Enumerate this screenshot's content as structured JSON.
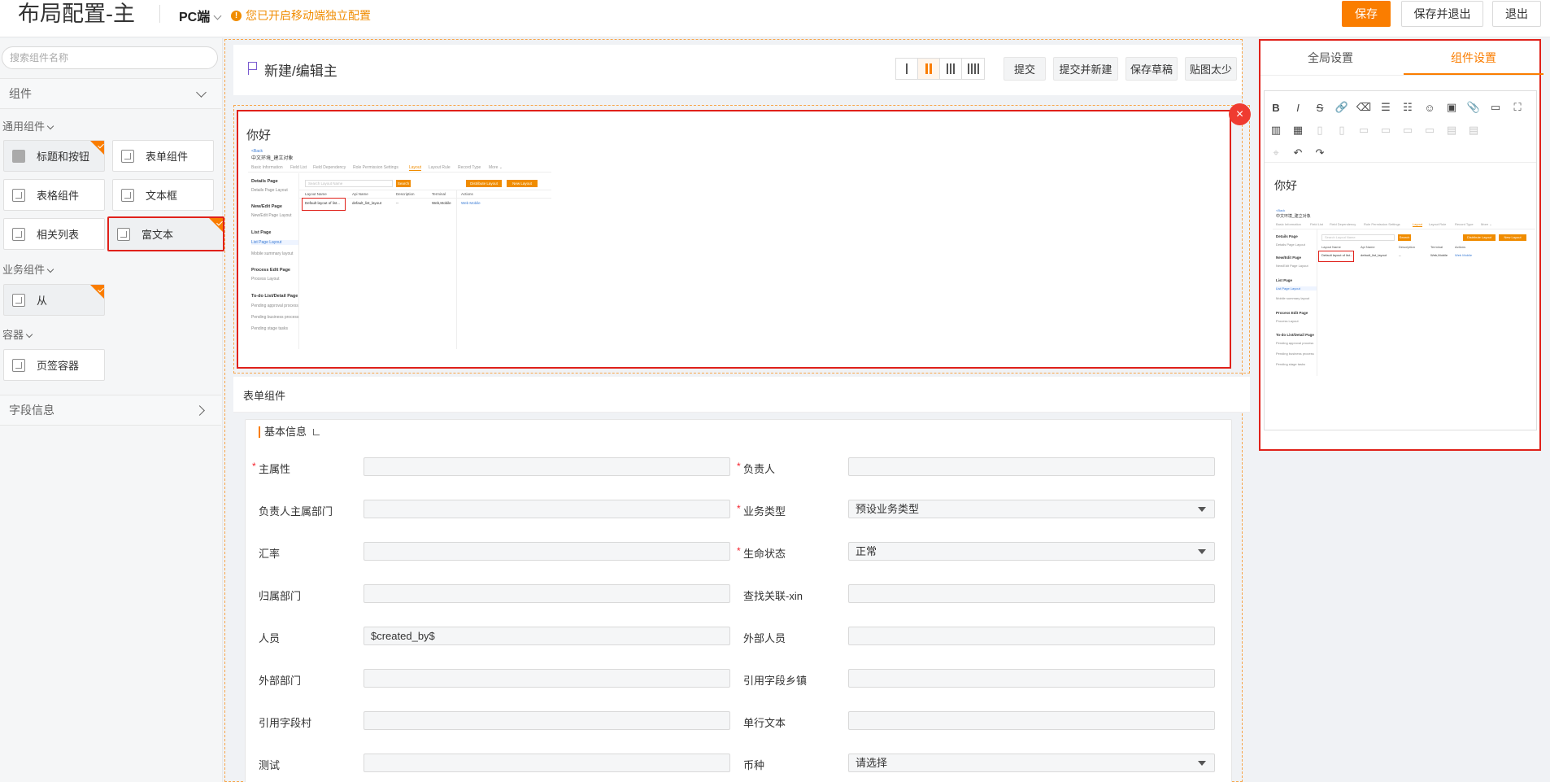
{
  "header": {
    "title": "布局配置-主",
    "platform": "PC端",
    "warning": "您已开启移动端独立配置",
    "buttons": {
      "save": "保存",
      "save_exit": "保存并退出",
      "exit": "退出"
    }
  },
  "left": {
    "search_placeholder": "搜索组件名称",
    "components_section": "组件",
    "groups": {
      "common": "通用组件",
      "business": "业务组件",
      "container": "容器"
    },
    "common_items": [
      "标题和按钮",
      "表单组件",
      "表格组件",
      "文本框",
      "相关列表",
      "富文本"
    ],
    "business_items": [
      "从"
    ],
    "container_items": [
      "页签容器"
    ],
    "fields_section": "字段信息"
  },
  "canvas": {
    "page_title": "新建/编辑主",
    "actions": [
      "提交",
      "提交并新建",
      "保存草稿",
      "贴图太少"
    ],
    "rich_text_hello": "你好",
    "form_section_title": "表单组件",
    "form_group_title": "基本信息",
    "fields": [
      {
        "label": "主属性",
        "required": true,
        "value": "",
        "dropdown": false
      },
      {
        "label": "负责人",
        "required": true,
        "value": "",
        "dropdown": false
      },
      {
        "label": "负责人主属部门",
        "required": false,
        "value": "",
        "dropdown": false
      },
      {
        "label": "业务类型",
        "required": true,
        "value": "预设业务类型",
        "dropdown": true
      },
      {
        "label": "汇率",
        "required": false,
        "value": "",
        "dropdown": false
      },
      {
        "label": "生命状态",
        "required": true,
        "value": "正常",
        "dropdown": true
      },
      {
        "label": "归属部门",
        "required": false,
        "value": "",
        "dropdown": false
      },
      {
        "label": "查找关联-xin",
        "required": false,
        "value": "",
        "dropdown": false
      },
      {
        "label": "人员",
        "required": false,
        "value": "$created_by$",
        "dropdown": false
      },
      {
        "label": "外部人员",
        "required": false,
        "value": "",
        "dropdown": false
      },
      {
        "label": "外部部门",
        "required": false,
        "value": "",
        "dropdown": false
      },
      {
        "label": "引用字段乡镇",
        "required": false,
        "value": "",
        "dropdown": false
      },
      {
        "label": "引用字段村",
        "required": false,
        "value": "",
        "dropdown": false
      },
      {
        "label": "单行文本",
        "required": false,
        "value": "",
        "dropdown": false
      },
      {
        "label": "测试",
        "required": false,
        "value": "",
        "dropdown": false
      },
      {
        "label": "币种",
        "required": false,
        "value": "请选择",
        "dropdown": true
      }
    ]
  },
  "embedded_screenshot": {
    "back": "<Back",
    "title": "中文环境_建立对象",
    "tabs": [
      "Basic Information",
      "Field List",
      "Field Dependency",
      "Role Permission Settings",
      "Layout",
      "Layout Rule",
      "Record Type",
      "More ⌄"
    ],
    "active_tab": "Layout",
    "side": [
      {
        "h": "Details Page",
        "items": [
          "Details Page Layout"
        ]
      },
      {
        "h": "New/Edit Page",
        "items": [
          "New/Edit Page Layout"
        ]
      },
      {
        "h": "List Page",
        "items": [
          "List Page Layout",
          "Mobile summary layout"
        ]
      },
      {
        "h": "Process Edit Page",
        "items": [
          "Process Layout"
        ]
      },
      {
        "h": "To-do List/Detail Page",
        "items": [
          "Pending approval process",
          "Pending business process",
          "Pending stage tasks"
        ]
      }
    ],
    "search_placeholder": "Search Layout Name",
    "search_btn": "Search",
    "btn_distribute": "Distribute Layout",
    "btn_new": "New Layout",
    "columns": [
      "Layout Name",
      "Api Name",
      "Description",
      "Terminal",
      "Actions"
    ],
    "row": [
      "Default layout of list...",
      "default_list_layout",
      "--",
      "Web,Mobile",
      "Web  Mobile"
    ]
  },
  "right": {
    "tabs": [
      "全局设置",
      "组件设置"
    ],
    "active_tab": "组件设置",
    "editor_hello": "你好",
    "toolbar_row1": [
      "B",
      "I",
      "S",
      "🔗",
      "⌫",
      "☰",
      "☷",
      "☺",
      "▣",
      "📎",
      "▭",
      "⛶"
    ],
    "toolbar_row2": [
      "▥",
      "▦",
      "▯",
      "▯",
      "▭",
      "▭",
      "▭",
      "▭",
      "▤",
      "▤"
    ],
    "toolbar_row3": [
      "⌖",
      "↶",
      "↷"
    ]
  },
  "colors": {
    "accent": "#fa7d00",
    "highlight": "#e0211a",
    "link": "#3a7bd5"
  }
}
